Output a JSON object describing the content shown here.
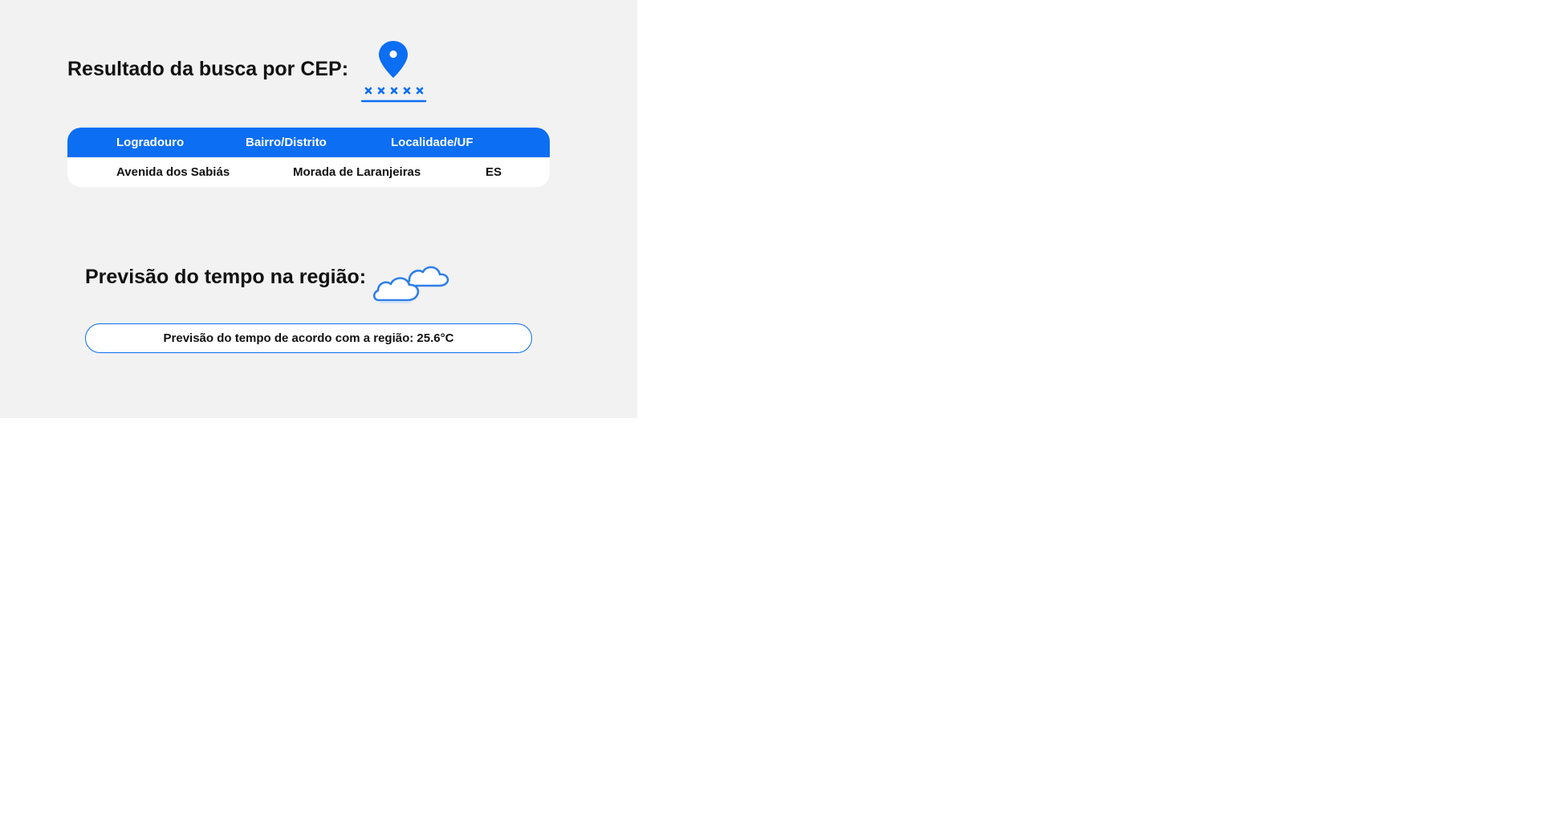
{
  "header": {
    "title": "Resultado da busca por CEP:"
  },
  "table": {
    "headers": [
      "Logradouro",
      "Bairro/Distrito",
      "Localidade/UF"
    ],
    "row": {
      "logradouro": "Avenida dos Sabiás",
      "bairro": "Morada de Laranjeiras",
      "uf": "ES"
    }
  },
  "weather": {
    "title": "Previsão do tempo na região:",
    "forecast_text": "Previsão do tempo de acordo com a região: 25.6°C"
  },
  "icons": {
    "location": "map-pin-icon",
    "weather": "cloud-icon"
  },
  "colors": {
    "accent": "#0b6ef3",
    "panel_background": "#f2f2f2",
    "text": "#111111"
  }
}
